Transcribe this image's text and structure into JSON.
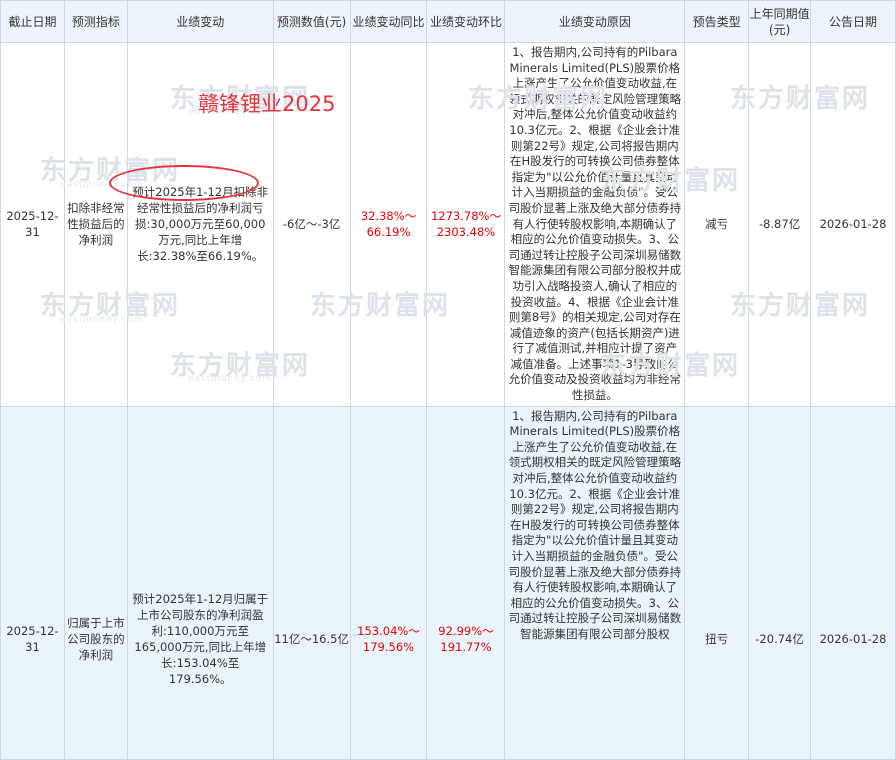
{
  "headers": [
    "截止日期",
    "预测指标",
    "业绩变动",
    "预测数值(元)",
    "业绩变动同比",
    "业绩变动环比",
    "业绩变动原因",
    "预告类型",
    "上年同期值(元)",
    "公告日期"
  ],
  "rows": [
    {
      "date": "2025-12-31",
      "indicator": "扣除非经常性损益后的净利润",
      "change": "预计2025年1-12月扣除非经常性损益后的净利润亏损:30,000万元至60,000万元,同比上年增长:32.38%至66.19%。",
      "forecast_value": "-6亿～-3亿",
      "yoy": "32.38%～66.19%",
      "qoq": "1273.78%～2303.48%",
      "reason": "1、报告期内,公司持有的Pilbara Minerals Limited(PLS)股票价格上涨产生了公允价值变动收益,在领式期权相关的既定风险管理策略对冲后,整体公允价值变动收益约10.3亿元。2、根据《企业会计准则第22号》规定,公司将报告期内在H股发行的可转换公司债券整体指定为\"以公允价值计量且其变动计入当期损益的金融负债\"。受公司股价显著上涨及绝大部分债券持有人行使转股权影响,本期确认了相应的公允价值变动损失。3、公司通过转让控股子公司深圳易储数智能源集团有限公司部分股权并成功引入战略投资人,确认了相应的投资收益。4、根据《企业会计准则第8号》的相关规定,公司对存在减值迹象的资产(包括长期资产)进行了减值测试,并相应计提了资产减值准备。上述事项1-3导致的公允价值变动及投资收益均为非经常性损益。",
      "type": "减亏",
      "last_year": "-8.87亿",
      "announce_date": "2026-01-28"
    },
    {
      "date": "2025-12-31",
      "indicator": "归属于上市公司股东的净利润",
      "change": "预计2025年1-12月归属于上市公司股东的净利润盈利:110,000万元至165,000万元,同比上年增长:153.04%至179.56%。",
      "forecast_value": "11亿～16.5亿",
      "yoy": "153.04%～179.56%",
      "qoq": "92.99%～191.77%",
      "reason": "1、报告期内,公司持有的Pilbara Minerals Limited(PLS)股票价格上涨产生了公允价值变动收益,在领式期权相关的既定风险管理策略对冲后,整体公允价值变动收益约10.3亿元。2、根据《企业会计准则第22号》规定,公司将报告期内在H股发行的可转换公司债券整体指定为\"以公允价值计量且其变动计入当期损益的金融负债\"。受公司股价显著上涨及绝大部分债券持有人行使转股权影响,本期确认了相应的公允价值变动损失。3、公司通过转让控股子公司深圳易储数智能源集团有限公司部分股权",
      "type": "扭亏",
      "last_year": "-20.74亿",
      "announce_date": "2026-01-28"
    }
  ],
  "overlay_title": "赣锋锂业2025",
  "watermark": {
    "cn": "东方财富网",
    "en": "eastmoney.com"
  },
  "colors": {
    "header_bg": "#edf4fb",
    "row_alt_bg": "#eaf5fb",
    "red": "#e60000",
    "border": "#c9d7e6"
  }
}
